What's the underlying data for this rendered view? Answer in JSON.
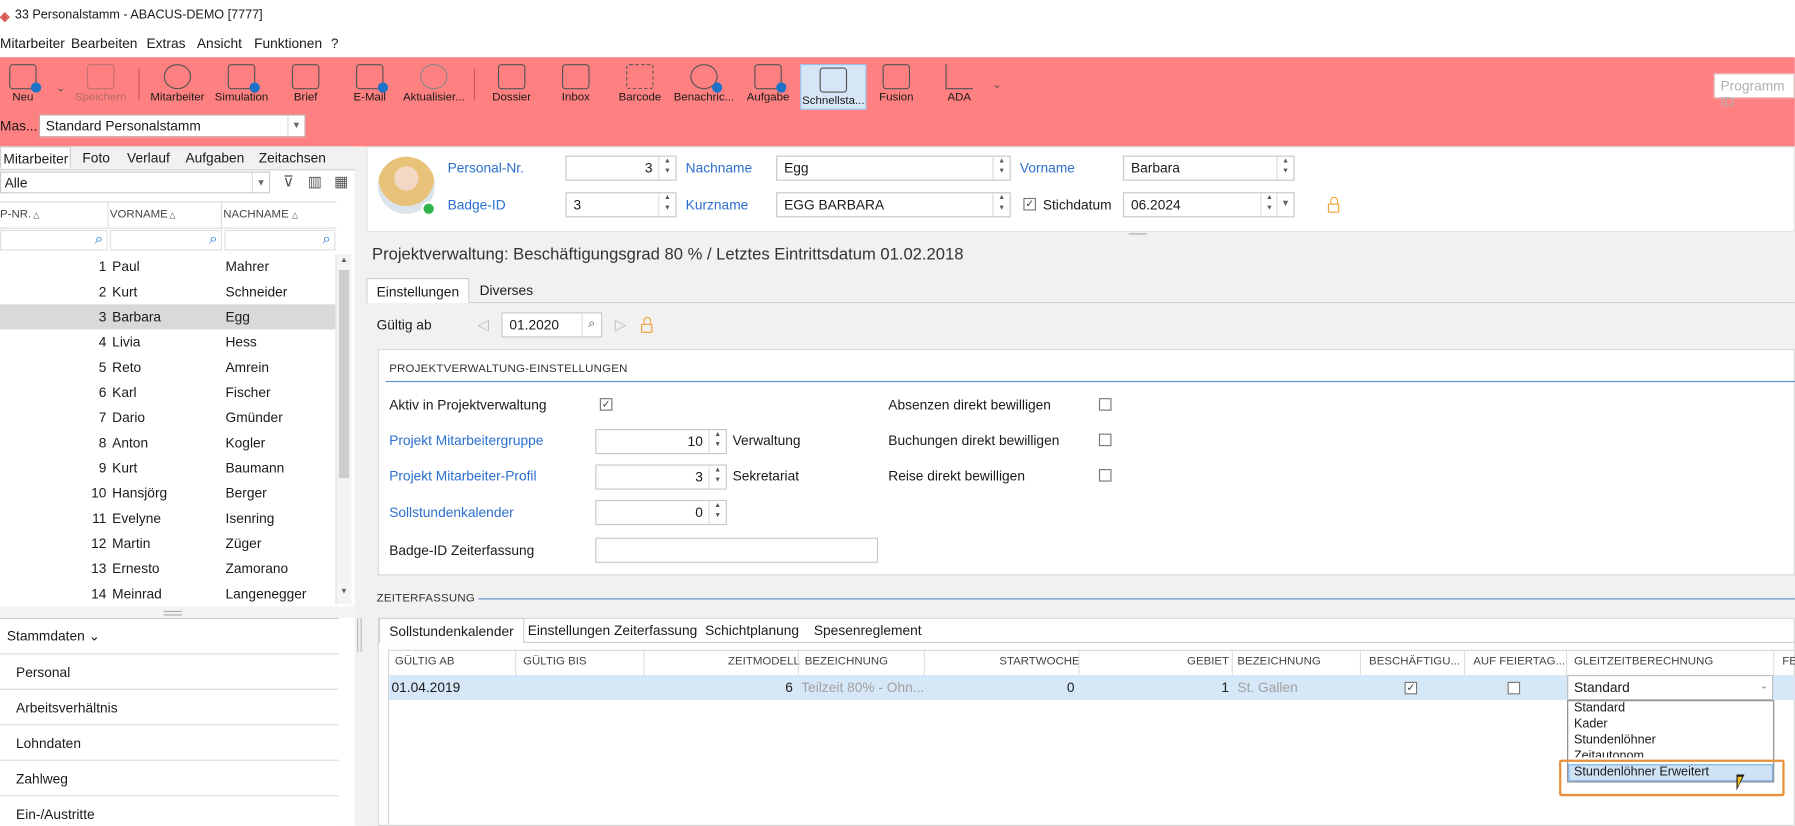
{
  "window": {
    "title": "33 Personalstamm - ABACUS-DEMO [7777]"
  },
  "menu": [
    "Mitarbeiter",
    "Bearbeiten",
    "Extras",
    "Ansicht",
    "Funktionen",
    "?"
  ],
  "toolbar": {
    "items": [
      {
        "label": "Neu",
        "icon": "new-person-icon"
      },
      {
        "label": "Speichern",
        "icon": "save-icon"
      },
      {
        "label": "Mitarbeiter",
        "icon": "check-circle-icon"
      },
      {
        "label": "Simulation",
        "icon": "simulation-icon"
      },
      {
        "label": "Brief",
        "icon": "letter-icon"
      },
      {
        "label": "E-Mail",
        "icon": "email-icon"
      },
      {
        "label": "Aktualisier...",
        "icon": "refresh-icon"
      },
      {
        "label": "Dossier",
        "icon": "dossier-icon"
      },
      {
        "label": "Inbox",
        "icon": "inbox-icon"
      },
      {
        "label": "Barcode",
        "icon": "barcode-icon"
      },
      {
        "label": "Benachric...",
        "icon": "notification-icon"
      },
      {
        "label": "Aufgabe",
        "icon": "task-icon"
      },
      {
        "label": "Schnellsta...",
        "icon": "quickstart-icon"
      },
      {
        "label": "Fusion",
        "icon": "fusion-icon"
      },
      {
        "label": "ADA",
        "icon": "ada-chart-icon"
      }
    ],
    "program_id_placeholder": "Programm ID",
    "mask_label": "Mas...",
    "mask_value": "Standard Personalstamm",
    "accent_color": "#ff8080"
  },
  "left": {
    "tabs": [
      "Mitarbeiter",
      "Foto",
      "Verlauf",
      "Aufgaben",
      "Zeitachsen"
    ],
    "filter_value": "Alle",
    "columns": [
      "P-NR.",
      "VORNAME",
      "NACHNAME"
    ],
    "rows": [
      {
        "nr": "1",
        "vorname": "Paul",
        "nachname": "Mahrer"
      },
      {
        "nr": "2",
        "vorname": "Kurt",
        "nachname": "Schneider"
      },
      {
        "nr": "3",
        "vorname": "Barbara",
        "nachname": "Egg"
      },
      {
        "nr": "4",
        "vorname": "Livia",
        "nachname": "Hess"
      },
      {
        "nr": "5",
        "vorname": "Reto",
        "nachname": "Amrein"
      },
      {
        "nr": "6",
        "vorname": "Karl",
        "nachname": "Fischer"
      },
      {
        "nr": "7",
        "vorname": "Dario",
        "nachname": "Gmünder"
      },
      {
        "nr": "8",
        "vorname": "Anton",
        "nachname": "Kogler"
      },
      {
        "nr": "9",
        "vorname": "Kurt",
        "nachname": "Baumann"
      },
      {
        "nr": "10",
        "vorname": "Hansjörg",
        "nachname": "Berger"
      },
      {
        "nr": "11",
        "vorname": "Evelyne",
        "nachname": "Isenring"
      },
      {
        "nr": "12",
        "vorname": "Martin",
        "nachname": "Züger"
      },
      {
        "nr": "13",
        "vorname": "Ernesto",
        "nachname": "Zamorano"
      },
      {
        "nr": "14",
        "vorname": "Meinrad",
        "nachname": "Langenegger"
      }
    ],
    "nav_header": "Stammdaten",
    "nav_items": [
      "Personal",
      "Arbeitsverhältnis",
      "Lohndaten",
      "Zahlweg",
      "Ein-/Austritte"
    ]
  },
  "header": {
    "personal_nr_label": "Personal-Nr.",
    "personal_nr": "3",
    "nachname_label": "Nachname",
    "nachname": "Egg",
    "vorname_label": "Vorname",
    "vorname": "Barbara",
    "badge_label": "Badge-ID",
    "badge": "3",
    "kurzname_label": "Kurzname",
    "kurzname": "EGG BARBARA",
    "stichdatum_label": "Stichdatum",
    "stichdatum": "06.2024"
  },
  "summary": "Projektverwaltung: Beschäftigungsgrad 80 % / Letztes Eintrittsdatum 01.02.2018",
  "main_tabs": [
    "Einstellungen",
    "Diverses"
  ],
  "gueltig_ab_label": "Gültig ab",
  "gueltig_ab": "01.2020",
  "projekt": {
    "title": "PROJEKTVERWALTUNG-EINSTELLUNGEN",
    "aktiv_label": "Aktiv in Projektverwaltung",
    "gruppe_label": "Projekt Mitarbeitergruppe",
    "gruppe_value": "10",
    "gruppe_text": "Verwaltung",
    "profil_label": "Projekt Mitarbeiter-Profil",
    "profil_value": "3",
    "profil_text": "Sekretariat",
    "soll_label": "Sollstundenkalender",
    "soll_value": "0",
    "badge_label": "Badge-ID Zeiterfassung",
    "absenzen_label": "Absenzen direkt bewilligen",
    "buchungen_label": "Buchungen direkt bewilligen",
    "reise_label": "Reise direkt bewilligen"
  },
  "zeiterfassung": {
    "title": "ZEITERFASSUNG",
    "tabs": [
      "Sollstundenkalender",
      "Einstellungen Zeiterfassung",
      "Schichtplanung",
      "Spesenreglement"
    ],
    "columns": [
      "GÜLTIG AB",
      "GÜLTIG BIS",
      "ZEITMODELL",
      "BEZEICHNUNG",
      "STARTWOCHE",
      "GEBIET",
      "BEZEICHNUNG",
      "BESCHÄFTIGU...",
      "AUF FEIERTAG...",
      "GLEITZEITBERECHNUNG",
      "FE"
    ],
    "row": {
      "gueltig_ab": "01.04.2019",
      "zeitmodell": "6",
      "bezeichnung": "Teilzeit 80% - Ohn...",
      "startwoche": "0",
      "gebiet": "1",
      "gebiet_bez": "St. Gallen",
      "gleitzeit": "Standard"
    },
    "dropdown_options": [
      "Standard",
      "Kader",
      "Stundenlöhner",
      "Zeitautonom",
      "Stundenlöhner Erweitert"
    ],
    "highlight_color": "#e8903a"
  }
}
